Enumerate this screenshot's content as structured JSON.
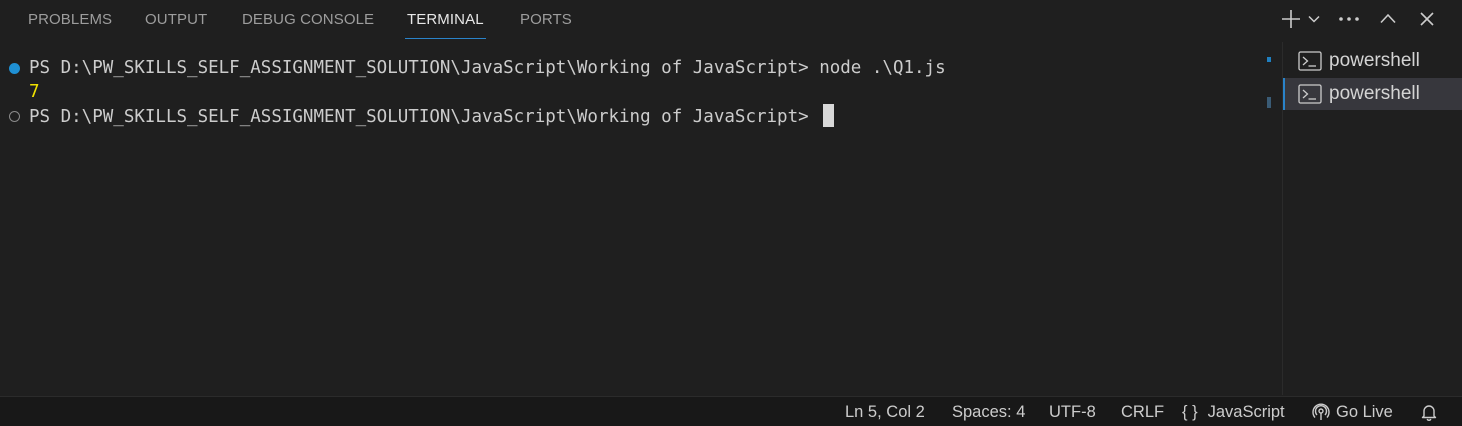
{
  "panel": {
    "tabs": [
      {
        "label": "PROBLEMS"
      },
      {
        "label": "OUTPUT"
      },
      {
        "label": "DEBUG CONSOLE"
      },
      {
        "label": "TERMINAL"
      },
      {
        "label": "PORTS"
      }
    ],
    "active_tab": "TERMINAL",
    "actions": {
      "new_terminal": "plus-icon",
      "launch_profile": "chevron-down-icon",
      "more": "ellipsis-icon",
      "maximize": "chevron-up-icon",
      "close": "close-icon"
    }
  },
  "terminal": {
    "lines": [
      {
        "text": "PS D:\\PW_SKILLS_SELF_ASSIGNMENT_SOLUTION\\JavaScript\\Working of JavaScript> node .\\Q1.js",
        "decoration": "success"
      },
      {
        "text": "7"
      },
      {
        "text": "PS D:\\PW_SKILLS_SELF_ASSIGNMENT_SOLUTION\\JavaScript\\Working of JavaScript> ",
        "decoration": "default"
      }
    ],
    "output_color": "#f0e100",
    "cursor": "block"
  },
  "terminal_list": {
    "items": [
      {
        "label": "powershell",
        "icon": "terminal-icon"
      },
      {
        "label": "powershell",
        "icon": "terminal-icon",
        "active": true
      }
    ]
  },
  "statusbar": {
    "position": "Ln 5, Col 2",
    "spaces": "Spaces: 4",
    "encoding": "UTF-8",
    "eol": "CRLF",
    "language_icon": "{ }",
    "language": "JavaScript",
    "go_live": "Go Live",
    "notifications_icon": "bell-icon"
  },
  "colors": {
    "background": "#1f1f1f",
    "accent": "#2a83c9",
    "statusbar_bg": "#181818"
  }
}
